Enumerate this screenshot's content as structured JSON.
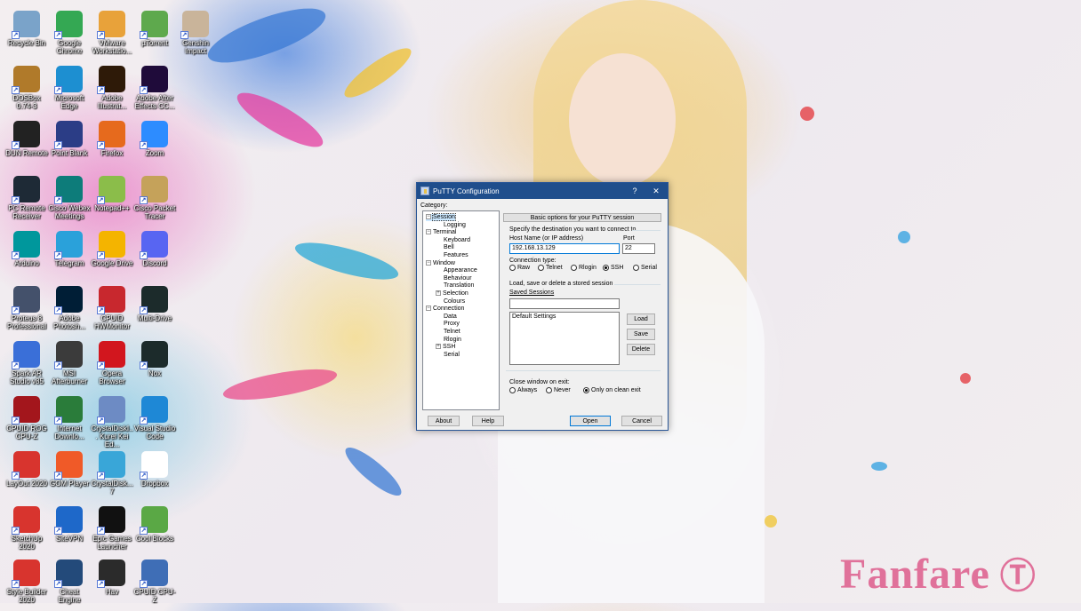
{
  "desktop_icons": [
    {
      "label": "Recycle Bin",
      "icon": "recycle-bin-icon",
      "color": "#7aa3c9"
    },
    {
      "label": "Google Chrome",
      "icon": "chrome-icon",
      "color": "#34a853"
    },
    {
      "label": "VMware Workstatio...",
      "icon": "vmware-icon",
      "color": "#e8a23a"
    },
    {
      "label": "µTorrent",
      "icon": "utorrent-icon",
      "color": "#5ea94d"
    },
    {
      "label": "Genshin Impact",
      "icon": "genshin-icon",
      "color": "#c9b49a"
    },
    {
      "label": "DOSBox 0.74-3",
      "icon": "dosbox-icon",
      "color": "#b07a2a"
    },
    {
      "label": "Microsoft Edge",
      "icon": "edge-icon",
      "color": "#1d8fd1"
    },
    {
      "label": "Adobe Illustrat...",
      "icon": "illustrator-icon",
      "color": "#2e1a08"
    },
    {
      "label": "Adobe After Effects CC...",
      "icon": "after-effects-icon",
      "color": "#1f0b3a"
    },
    {
      "label": "DUN Remote",
      "icon": "remote-icon",
      "color": "#222222"
    },
    {
      "label": "Point Blank",
      "icon": "pointblank-icon",
      "color": "#2b3d86"
    },
    {
      "label": "Firefox",
      "icon": "firefox-icon",
      "color": "#e66a1d"
    },
    {
      "label": "Zoom",
      "icon": "zoom-icon",
      "color": "#2d8cff"
    },
    {
      "label": "PC Remote Receiver",
      "icon": "pc-remote-icon",
      "color": "#1e2a36"
    },
    {
      "label": "Cisco Webex Meetings",
      "icon": "webex-icon",
      "color": "#0d7c7a"
    },
    {
      "label": "Notepad++",
      "icon": "notepad-icon",
      "color": "#8bbd4a"
    },
    {
      "label": "Cisco Packet Tracer",
      "icon": "packet-tracer-icon",
      "color": "#c5a25a"
    },
    {
      "label": "Arduino",
      "icon": "arduino-icon",
      "color": "#00979c"
    },
    {
      "label": "Telegram",
      "icon": "telegram-icon",
      "color": "#2aa1da"
    },
    {
      "label": "Google Drive",
      "icon": "drive-icon",
      "color": "#f4b400"
    },
    {
      "label": "Discord",
      "icon": "discord-icon",
      "color": "#5865f2"
    },
    {
      "label": "Proteus 8 Professional",
      "icon": "proteus-icon",
      "color": "#44516b"
    },
    {
      "label": "Adobe Photosh...",
      "icon": "photoshop-icon",
      "color": "#001e36"
    },
    {
      "label": "CPUID HWMonitor",
      "icon": "hwmonitor-icon",
      "color": "#c8282e"
    },
    {
      "label": "Multi-Drive",
      "icon": "multidrive-icon",
      "color": "#1c2b2b"
    },
    {
      "label": "Spark AR Studio v85",
      "icon": "spark-ar-icon",
      "color": "#3a6fd8"
    },
    {
      "label": "MSI Afterburner",
      "icon": "afterburner-icon",
      "color": "#3b3b3b"
    },
    {
      "label": "Opera Browser",
      "icon": "opera-icon",
      "color": "#d2161e"
    },
    {
      "label": "Nox",
      "icon": "nox-icon",
      "color": "#1c2b2b"
    },
    {
      "label": "CPUID ROG CPU-Z",
      "icon": "rog-cpuz-icon",
      "color": "#a3161c"
    },
    {
      "label": "Internet Downlo...",
      "icon": "idm-icon",
      "color": "#2a7c3a"
    },
    {
      "label": "CrystalDiskI... Kurei Kei Ed...",
      "icon": "crystaldisk-icon",
      "color": "#6d8bc4"
    },
    {
      "label": "Visual Studio Code",
      "icon": "vscode-icon",
      "color": "#1e88d6"
    },
    {
      "label": "LayOut 2020",
      "icon": "layout-icon",
      "color": "#d8342e"
    },
    {
      "label": "GOM Player",
      "icon": "gom-player-icon",
      "color": "#f05a28"
    },
    {
      "label": "CrystalDisk... 7",
      "icon": "crystaldisk2-icon",
      "color": "#39a6d8"
    },
    {
      "label": "Dropbox",
      "icon": "dropbox-icon",
      "color": "#ffffff"
    },
    {
      "label": "SketchUp 2020",
      "icon": "sketchup-icon",
      "color": "#d8342e"
    },
    {
      "label": "SiteVPN",
      "icon": "vpn-icon",
      "color": "#1e68c9"
    },
    {
      "label": "Epic Games Launcher",
      "icon": "epic-icon",
      "color": "#111111"
    },
    {
      "label": "Cool Blocks",
      "icon": "coolblocks-icon",
      "color": "#5aa845"
    },
    {
      "label": "Style Builder 2020",
      "icon": "style-builder-icon",
      "color": "#d8342e"
    },
    {
      "label": "Cheat Engine",
      "icon": "cheat-engine-icon",
      "color": "#234a7a"
    },
    {
      "label": "Hav",
      "icon": "hav-icon",
      "color": "#2b2b2b"
    },
    {
      "label": "CPUID CPU-Z",
      "icon": "cpuz-icon",
      "color": "#3f6eb6"
    }
  ],
  "wallpaper": {
    "logo_text": "Fanfare",
    "logo_color": "#e0719a"
  },
  "putty": {
    "title": "PuTTY Configuration",
    "help_btn": "?",
    "close_btn": "✕",
    "category_label": "Category:",
    "tree": [
      {
        "label": "Session",
        "level": 0,
        "expand": "⊟"
      },
      {
        "label": "Logging",
        "level": 1
      },
      {
        "label": "Terminal",
        "level": 0,
        "expand": "⊟"
      },
      {
        "label": "Keyboard",
        "level": 1
      },
      {
        "label": "Bell",
        "level": 1
      },
      {
        "label": "Features",
        "level": 1
      },
      {
        "label": "Window",
        "level": 0,
        "expand": "⊟"
      },
      {
        "label": "Appearance",
        "level": 1
      },
      {
        "label": "Behaviour",
        "level": 1
      },
      {
        "label": "Translation",
        "level": 1
      },
      {
        "label": "Selection",
        "level": 1,
        "expand": "⊞"
      },
      {
        "label": "Colours",
        "level": 1
      },
      {
        "label": "Connection",
        "level": 0,
        "expand": "⊟"
      },
      {
        "label": "Data",
        "level": 1
      },
      {
        "label": "Proxy",
        "level": 1
      },
      {
        "label": "Telnet",
        "level": 1
      },
      {
        "label": "Rlogin",
        "level": 1
      },
      {
        "label": "SSH",
        "level": 1,
        "expand": "⊞"
      },
      {
        "label": "Serial",
        "level": 1
      }
    ],
    "header_button": "Basic options for your PuTTY session",
    "specify_label": "Specify the destination you want to connect to",
    "host_label": "Host Name (or IP address)",
    "host_value": "192.168.13.129",
    "port_label": "Port",
    "port_value": "22",
    "conn_type_label": "Connection type:",
    "conn_types": [
      {
        "label": "Raw",
        "selected": false
      },
      {
        "label": "Telnet",
        "selected": false
      },
      {
        "label": "Rlogin",
        "selected": false
      },
      {
        "label": "SSH",
        "selected": true
      },
      {
        "label": "Serial",
        "selected": false
      }
    ],
    "load_save_label": "Load, save or delete a stored session",
    "saved_sessions_label": "Saved Sessions",
    "saved_sessions_value": "",
    "sessions": [
      "Default Settings"
    ],
    "load_btn": "Load",
    "save_btn": "Save",
    "delete_btn": "Delete",
    "close_window_label": "Close window on exit:",
    "close_options": [
      {
        "label": "Always",
        "selected": false
      },
      {
        "label": "Never",
        "selected": false
      },
      {
        "label": "Only on clean exit",
        "selected": true
      }
    ],
    "about_btn": "About",
    "help_btn_bottom": "Help",
    "open_btn": "Open",
    "cancel_btn": "Cancel"
  }
}
